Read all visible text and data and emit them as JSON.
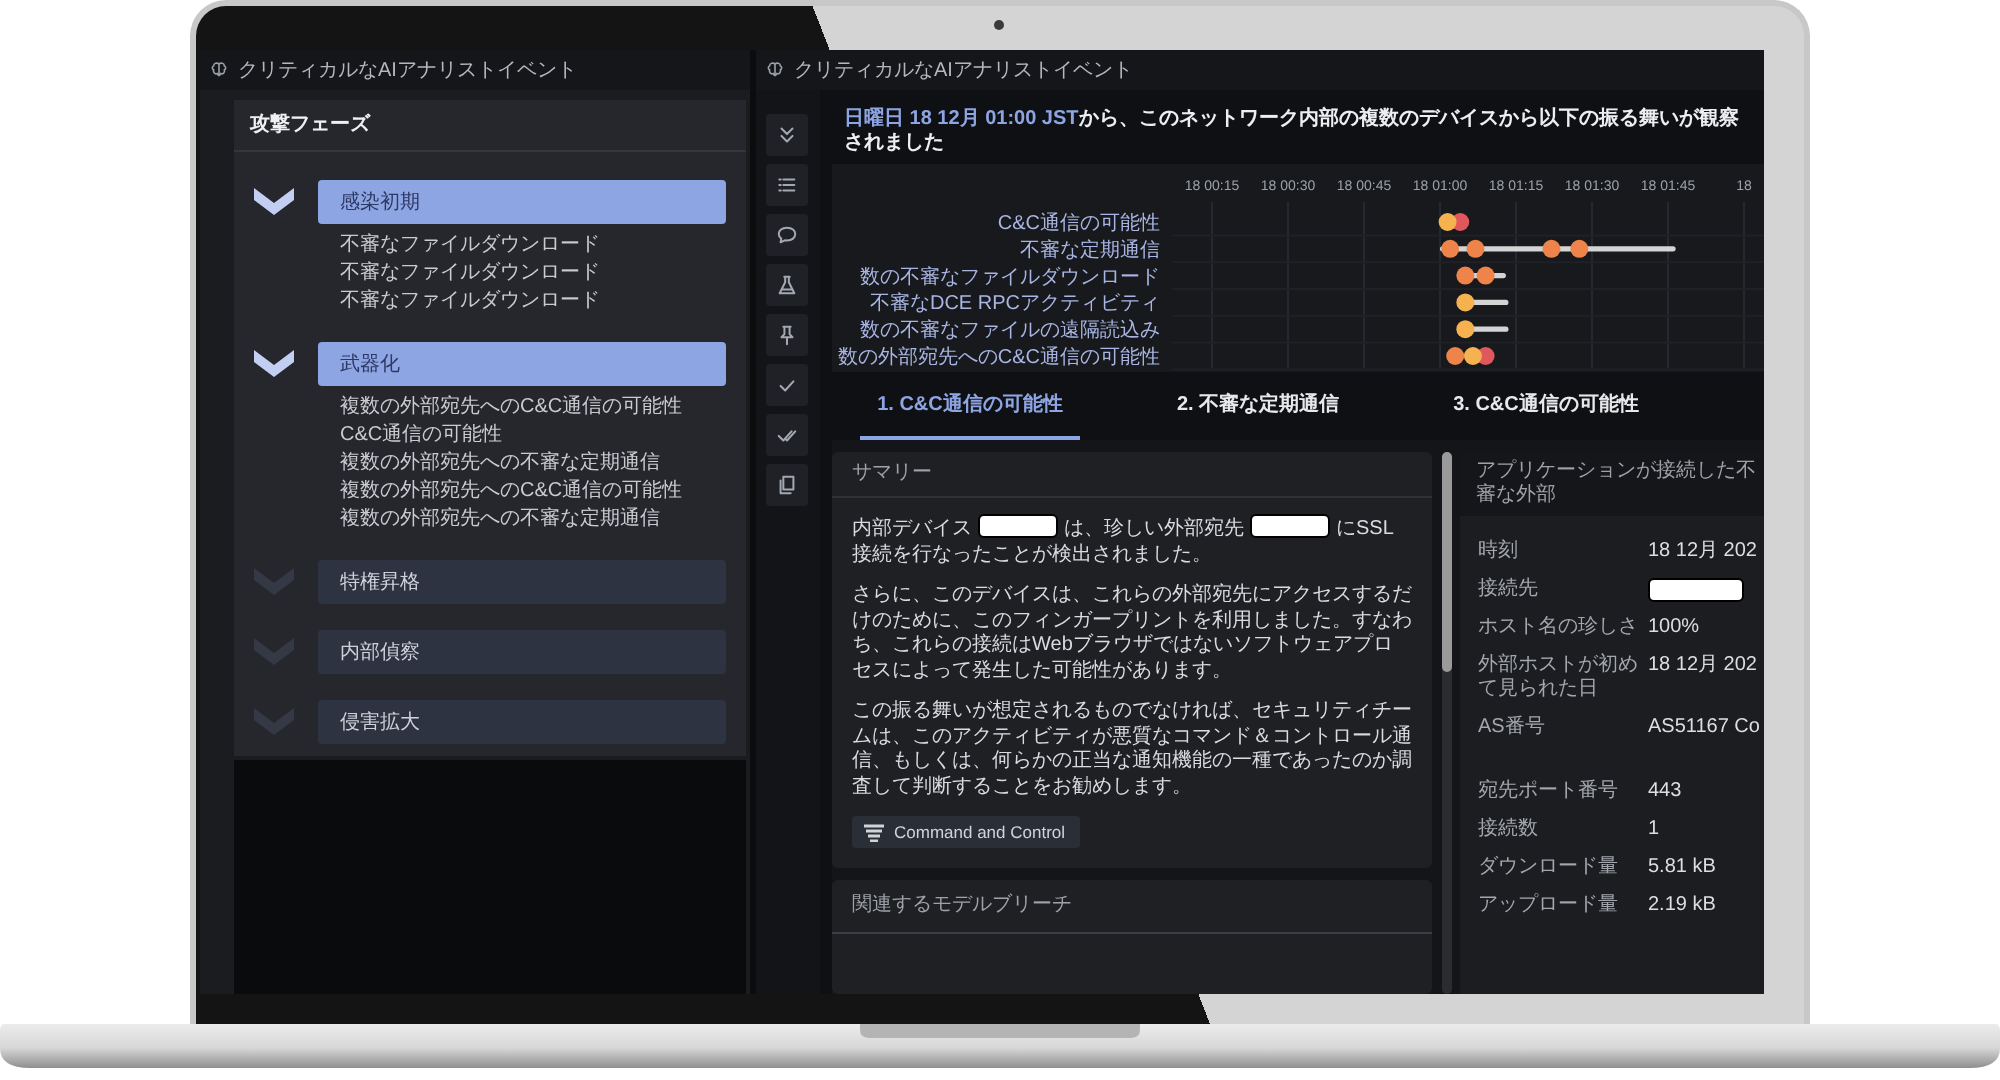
{
  "left_window": {
    "title": "クリティカルなAIアナリストイベント",
    "attack_phases": {
      "title": "攻撃フェーズ",
      "items": [
        {
          "label": "感染初期",
          "expanded": true,
          "children": [
            {
              "label": "不審なファイルダウンロード"
            },
            {
              "label": "不審なファイルダウンロード"
            },
            {
              "label": "不審なファイルダウンロード"
            }
          ]
        },
        {
          "label": "武器化",
          "expanded": true,
          "children": [
            {
              "label": "複数の外部宛先へのC&C通信の可能性"
            },
            {
              "label": "C&C通信の可能性"
            },
            {
              "label": "複数の外部宛先への不審な定期通信"
            },
            {
              "label": "複数の外部宛先へのC&C通信の可能性"
            },
            {
              "label": "複数の外部宛先への不審な定期通信"
            }
          ]
        },
        {
          "label": "特権昇格",
          "expanded": false
        },
        {
          "label": "内部偵察",
          "expanded": false
        },
        {
          "label": "侵害拡大",
          "expanded": false
        }
      ]
    }
  },
  "right_window": {
    "title": "クリティカルなAIアナリストイベント",
    "headline": {
      "date": "日曜日 18 12月 01:00 JST",
      "text": "から、このネットワーク内部の複数のデバイスから以下の振る舞いが観察されました"
    },
    "timeline": {
      "time_labels": [
        "18 00:15",
        "18 00:30",
        "18 00:45",
        "18 01:00",
        "18 01:15",
        "18 01:30",
        "18 01:45",
        "18"
      ],
      "row_labels": [
        "C&C通信の可能性",
        "不審な定期通信",
        "数の不審なファイルダウンロード",
        "不審なDCE RPCアクティビティ",
        "数の不審なファイルの遠隔読込み",
        "数の外部宛先へのC&C通信の可能性"
      ]
    },
    "tabs": [
      {
        "label": "1. C&C通信の可能性",
        "selected": true
      },
      {
        "label": "2. 不審な定期通信",
        "selected": false
      },
      {
        "label": "3. C&C通信の可能性",
        "selected": false
      }
    ],
    "summary": {
      "title": "サマリー",
      "paragraphs": [
        [
          {
            "kind": "text",
            "text": "内部デバイス"
          },
          {
            "kind": "redacted"
          },
          {
            "kind": "text",
            "text": "は、珍しい外部宛先"
          },
          {
            "kind": "redacted"
          },
          {
            "kind": "text",
            "text": "にSSL接続を行なったことが検出されました。"
          }
        ],
        [
          {
            "kind": "text",
            "text": "さらに、このデバイスは、これらの外部宛先にアクセスするだけのために、このフィンガープリントを利用しました。すなわち、これらの接続はWebブラウザではないソフトウェアプロセスによって発生した可能性があります。"
          }
        ],
        [
          {
            "kind": "text",
            "text": "この振る舞いが想定されるものでなければ、セキュリティチームは、このアクティビティが悪質なコマンド＆コントロール通信、もしくは、何らかの正当な通知機能の一種であったのか調査して判断することをお勧めします。"
          }
        ]
      ],
      "tag": "Command and Control"
    },
    "related": {
      "title": "関連するモデルブリーチ"
    },
    "details": {
      "title": "アプリケーションが接続した不審な外部",
      "groups": [
        {
          "rows": [
            {
              "label": "時刻",
              "kind": "text",
              "value": "18 12月 202"
            },
            {
              "label": "接続先",
              "kind": "redacted"
            },
            {
              "label": "ホスト名の珍しさ",
              "kind": "text",
              "value": "100%"
            },
            {
              "label": "外部ホストが初めて見られた日",
              "kind": "text",
              "value": "18 12月 202"
            },
            {
              "label": "AS番号",
              "kind": "text",
              "value": "AS51167 Co"
            }
          ]
        },
        {
          "rows": [
            {
              "label": "宛先ポート番号",
              "kind": "text",
              "value": "443"
            },
            {
              "label": "接続数",
              "kind": "text",
              "value": "1"
            },
            {
              "label": "ダウンロード量",
              "kind": "text",
              "value": "5.81 kB"
            },
            {
              "label": "アップロード量",
              "kind": "text",
              "value": "2.19 kB"
            }
          ]
        }
      ]
    }
  }
}
